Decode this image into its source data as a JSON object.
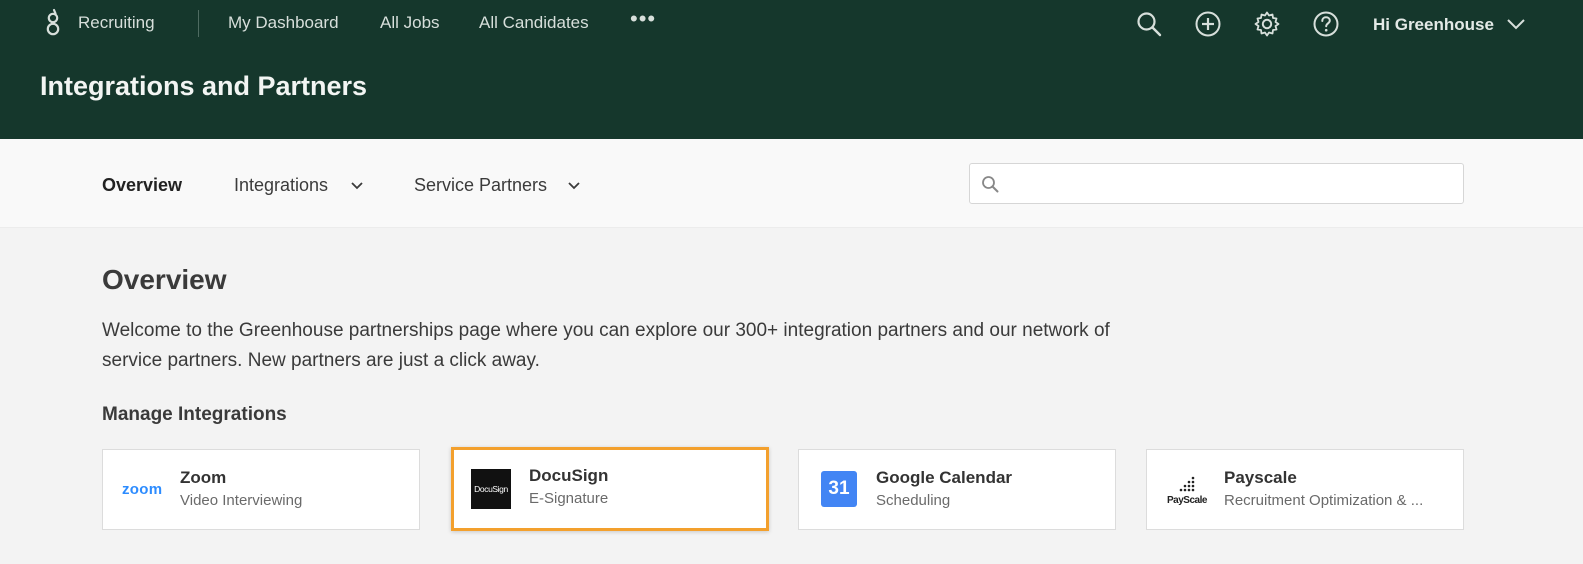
{
  "header": {
    "brand": "Recruiting",
    "nav": [
      "My Dashboard",
      "All Jobs",
      "All Candidates"
    ],
    "more": "•••",
    "greeting": "Hi Greenhouse",
    "page_title": "Integrations and Partners",
    "icons": [
      "search-icon",
      "add-icon",
      "gear-icon",
      "help-icon"
    ],
    "color": "#15372c"
  },
  "subnav": {
    "items": [
      "Overview",
      "Integrations",
      "Service Partners"
    ],
    "active": "Overview",
    "search_placeholder": ""
  },
  "main": {
    "title": "Overview",
    "intro": "Welcome to the Greenhouse partnerships page where you can explore our 300+ integration partners and our network of service partners. New partners are just a click away.",
    "section_title": "Manage Integrations",
    "cards": [
      {
        "name": "Zoom",
        "category": "Video Interviewing",
        "logo_text": "zoom",
        "logo_color": "#2d8cff"
      },
      {
        "name": "DocuSign",
        "category": "E-Signature",
        "logo_text": "DocuSign",
        "highlighted": true,
        "highlight_color": "#f3a02d"
      },
      {
        "name": "Google Calendar",
        "category": "Scheduling",
        "logo_text": "31",
        "logo_color": "#4285f4"
      },
      {
        "name": "Payscale",
        "category": "Recruitment Optimization & ...",
        "logo_text": "PayScale"
      }
    ]
  }
}
